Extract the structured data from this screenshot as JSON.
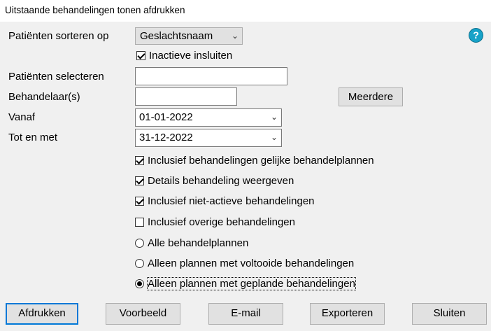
{
  "window": {
    "title": "Uitstaande behandelingen tonen afdrukken"
  },
  "form": {
    "sort_label": "Patiënten sorteren op",
    "sort_value": "Geslachtsnaam",
    "inactive_label": "Inactieve insluiten",
    "select_patients_label": "Patiënten selecteren",
    "select_patients_value": "",
    "practitioners_label": "Behandelaar(s)",
    "practitioners_value": "",
    "multiple_button": "Meerdere",
    "from_label": "Vanaf",
    "from_value": "01-01-2022",
    "to_label": "Tot en met",
    "to_value": "31-12-2022"
  },
  "options": {
    "same_plans": "Inclusief behandelingen gelijke behandelplannen",
    "details": "Details behandeling weergeven",
    "non_active": "Inclusief niet-actieve behandelingen",
    "other": "Inclusief overige behandelingen",
    "all_plans": "Alle behandelplannen",
    "completed_plans": "Alleen plannen met voltooide behandelingen",
    "planned_plans": "Alleen plannen met geplande behandelingen"
  },
  "buttons": {
    "print": "Afdrukken",
    "preview": "Voorbeeld",
    "email": "E-mail",
    "export": "Exporteren",
    "close": "Sluiten"
  },
  "icons": {
    "help": "help-icon",
    "dropdown": "chevron-down-icon"
  },
  "colors": {
    "accent": "#0078d7",
    "help": "#17a2c8"
  }
}
